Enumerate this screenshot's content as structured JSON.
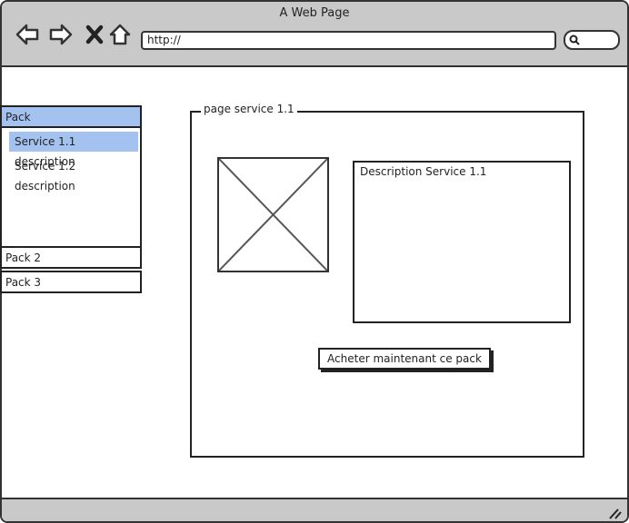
{
  "window": {
    "title": "A Web Page",
    "url": "http://"
  },
  "icons": {
    "back": "arrow-left-icon",
    "forward": "arrow-right-icon",
    "stop": "close-icon",
    "home": "home-icon",
    "search": "search-icon",
    "resize": "resize-grip-icon",
    "image_placeholder": "image-placeholder-icon"
  },
  "sidebar": {
    "packs": [
      {
        "label": "Pack",
        "expanded": true,
        "items": [
          {
            "label": "Service 1.1 description",
            "selected": true
          },
          {
            "label": "Service 1.2 description",
            "selected": false
          }
        ]
      },
      {
        "label": "Pack 2",
        "expanded": false
      },
      {
        "label": "Pack 3",
        "expanded": false
      }
    ]
  },
  "main": {
    "section_title": "page service 1.1",
    "description_title": "Description Service 1.1",
    "buy_button": "Acheter maintenant ce pack"
  },
  "colors": {
    "chrome": "#c9c9c9",
    "selection": "#a3c2f0",
    "border": "#222222"
  }
}
